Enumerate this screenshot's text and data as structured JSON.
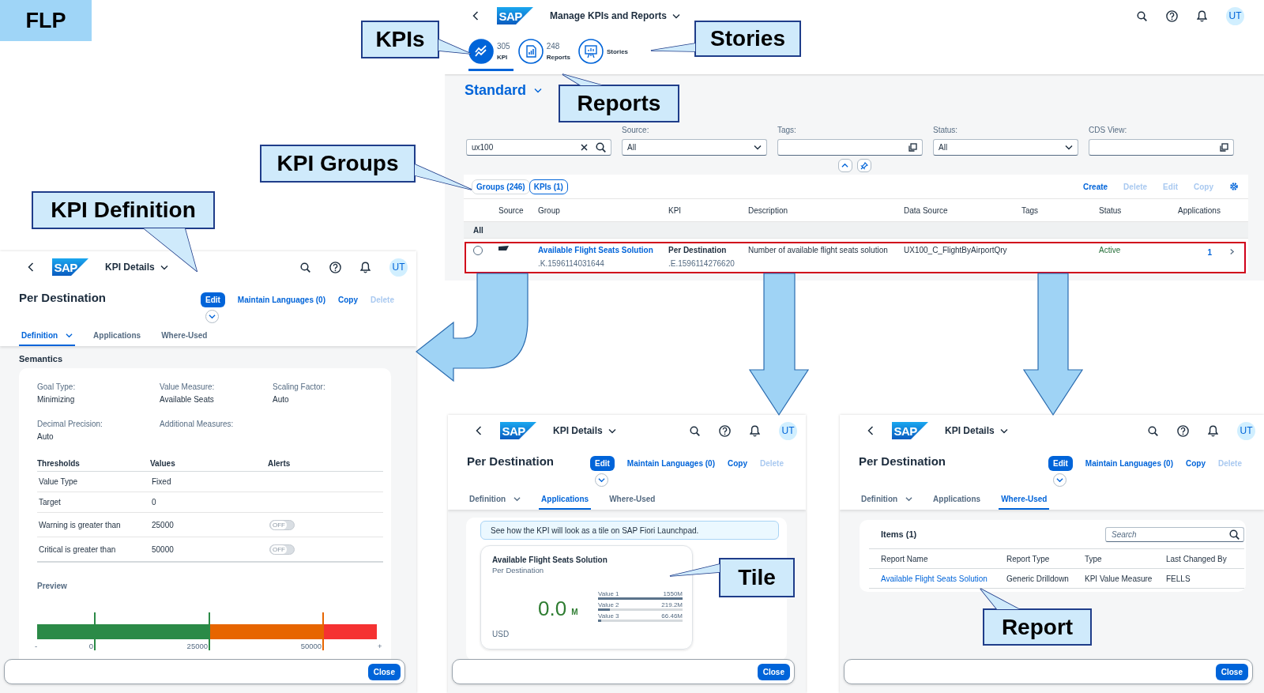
{
  "slide_tag": "FLP",
  "main_app": {
    "logo": "SAP",
    "title": "Manage KPIs and Reports",
    "avatar": "UT",
    "object_tabs": [
      {
        "kind": "kpi",
        "count": "305",
        "label": "KPI",
        "selected": true
      },
      {
        "kind": "reports",
        "count": "248",
        "label": "Reports",
        "selected": false
      },
      {
        "kind": "stories",
        "label": "Stories",
        "selected": false
      }
    ],
    "variant": "Standard",
    "filters": [
      {
        "kind": "search",
        "value": "ux100"
      },
      {
        "kind": "select",
        "label": "Source:",
        "value": "All"
      },
      {
        "kind": "value_help",
        "label": "Tags:"
      },
      {
        "kind": "select",
        "label": "Status:",
        "value": "All"
      },
      {
        "kind": "value_help",
        "label": "CDS View:"
      }
    ],
    "segments": [
      {
        "label": "Groups (246)",
        "selected": false
      },
      {
        "label": "KPIs (1)",
        "selected": true
      }
    ],
    "toolbar_actions": [
      {
        "label": "Create",
        "disabled": false
      },
      {
        "label": "Delete",
        "disabled": true
      },
      {
        "label": "Edit",
        "disabled": true
      },
      {
        "label": "Copy",
        "disabled": true
      }
    ],
    "table": {
      "columns": [
        "Source",
        "Group",
        "KPI",
        "Description",
        "Data Source",
        "Tags",
        "Status",
        "Applications"
      ],
      "group_header": "All",
      "rows": [
        {
          "selected": false,
          "group": "Available Flight Seats Solution",
          "group_id": ".K.1596114031644",
          "kpi": "Per Destination",
          "kpi_id": ".E.1596114276620",
          "description": "Number of available flight seats solution",
          "data_source": "UX100_C_FlightByAirportQry",
          "status": "Active",
          "applications": "1"
        }
      ]
    }
  },
  "detail_panels": [
    {
      "logo": "SAP",
      "title": "KPI Details",
      "avatar": "UT",
      "object_title": "Per Destination",
      "actions": [
        {
          "kind": "button",
          "label": "Edit",
          "disabled": false
        },
        {
          "kind": "link",
          "label": "Maintain Languages (0)",
          "disabled": false
        },
        {
          "kind": "link",
          "label": "Copy",
          "disabled": false
        },
        {
          "kind": "link",
          "label": "Delete",
          "disabled": true
        }
      ],
      "tabs": [
        {
          "label": "Definition",
          "menu": true,
          "selected": true
        },
        {
          "label": "Applications",
          "menu": false,
          "selected": false
        },
        {
          "label": "Where-Used",
          "menu": false,
          "selected": false
        }
      ],
      "content": {
        "kind": "definition",
        "section_title": "Semantics",
        "fields": [
          {
            "label": "Goal Type:",
            "value": "Minimizing"
          },
          {
            "label": "Value Measure:",
            "value": "Available Seats"
          },
          {
            "label": "Scaling Factor:",
            "value": "Auto"
          },
          {
            "label": "Decimal Precision:",
            "value": "Auto"
          },
          {
            "label": "Additional Measures:"
          }
        ],
        "thresholds": {
          "columns": [
            "Thresholds",
            "Values",
            "Alerts"
          ],
          "rows": [
            {
              "name": "Value Type",
              "value": "Fixed"
            },
            {
              "name": "Target",
              "value": "0"
            },
            {
              "name": "Warning is greater than",
              "value": "25000",
              "alert": {
                "text": "OFF",
                "on": false
              }
            },
            {
              "name": "Critical is greater than",
              "value": "50000",
              "alert": {
                "text": "OFF",
                "on": false
              }
            }
          ]
        },
        "preview": {
          "title": "Preview",
          "segments": [
            {
              "color": "#2b8a47"
            },
            {
              "color": "#2b8a47"
            },
            {
              "color": "#e76500"
            },
            {
              "color": "#f53232"
            }
          ],
          "scale_labels": [
            "-",
            "0",
            "25000",
            "50000",
            "+"
          ]
        }
      },
      "footer_button": "Close"
    },
    {
      "logo": "SAP",
      "title": "KPI Details",
      "avatar": "UT",
      "object_title": "Per Destination",
      "actions": [
        {
          "kind": "button",
          "label": "Edit",
          "disabled": false
        },
        {
          "kind": "link",
          "label": "Maintain Languages (0)",
          "disabled": false
        },
        {
          "kind": "link",
          "label": "Copy",
          "disabled": false
        },
        {
          "kind": "link",
          "label": "Delete",
          "disabled": true
        }
      ],
      "tabs": [
        {
          "label": "Definition",
          "menu": true,
          "selected": false
        },
        {
          "label": "Applications",
          "menu": false,
          "selected": true
        },
        {
          "label": "Where-Used",
          "menu": false,
          "selected": false
        }
      ],
      "content": {
        "kind": "applications",
        "message": "See how the KPI will look as a tile on SAP Fiori Launchpad.",
        "tile": {
          "title": "Available Flight Seats Solution",
          "subtitle": "Per Destination",
          "value": "0.0",
          "scale": "M",
          "unit": "USD",
          "bars": [
            {
              "label": "Value 1",
              "value": "1550M",
              "level": 1
            },
            {
              "label": "Value 2",
              "value": "219.2M",
              "level": 0.14
            },
            {
              "label": "Value 3",
              "value": "66.46M",
              "level": 0.04
            }
          ]
        }
      },
      "footer_button": "Close"
    },
    {
      "logo": "SAP",
      "title": "KPI Details",
      "avatar": "UT",
      "object_title": "Per Destination",
      "actions": [
        {
          "kind": "button",
          "label": "Edit",
          "disabled": false
        },
        {
          "kind": "link",
          "label": "Maintain Languages (0)",
          "disabled": false
        },
        {
          "kind": "link",
          "label": "Copy",
          "disabled": false
        },
        {
          "kind": "link",
          "label": "Delete",
          "disabled": true
        }
      ],
      "tabs": [
        {
          "label": "Definition",
          "menu": true,
          "selected": false
        },
        {
          "label": "Applications",
          "menu": false,
          "selected": false
        },
        {
          "label": "Where-Used",
          "menu": false,
          "selected": true
        }
      ],
      "content": {
        "kind": "where_used",
        "title": "Items (1)",
        "search_placeholder": "Search",
        "columns": [
          "Report Name",
          "Report Type",
          "Type",
          "Last Changed By"
        ],
        "rows": [
          {
            "cells": [
              "Available Flight Seats Solution",
              "Generic Drilldown",
              "KPI Value Measure",
              "FELLS"
            ]
          }
        ]
      },
      "footer_button": "Close"
    }
  ],
  "callouts": [
    {
      "text": "KPIs"
    },
    {
      "text": "Stories"
    },
    {
      "text": "Reports"
    },
    {
      "text": "KPI Groups"
    },
    {
      "text": "KPI Definition"
    },
    {
      "text": "Tile"
    },
    {
      "text": "Report"
    }
  ]
}
